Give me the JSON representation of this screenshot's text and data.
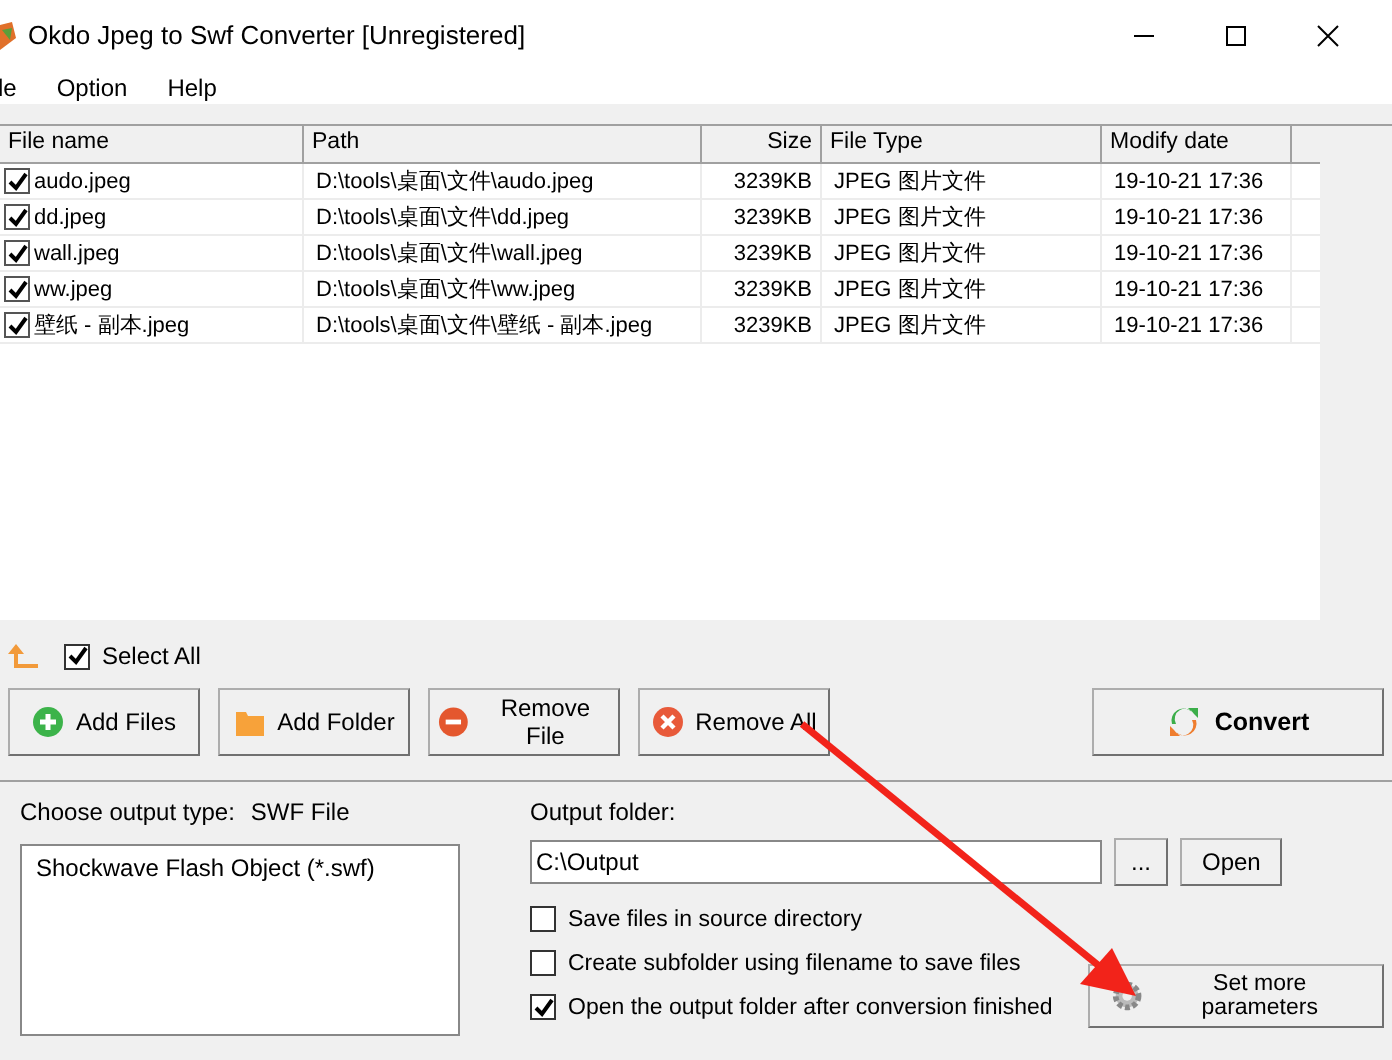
{
  "window": {
    "title": "Okdo Jpeg to Swf Converter [Unregistered]"
  },
  "menu": [
    "le",
    "Option",
    "Help"
  ],
  "table": {
    "columns": [
      "File name",
      "Path",
      "Size",
      "File Type",
      "Modify date"
    ],
    "rows": [
      {
        "checked": true,
        "cells": [
          "audo.jpeg",
          "D:\\tools\\桌面\\文件\\audo.jpeg",
          "3239KB",
          "JPEG 图片文件",
          "19-10-21 17:36"
        ]
      },
      {
        "checked": true,
        "cells": [
          "dd.jpeg",
          "D:\\tools\\桌面\\文件\\dd.jpeg",
          "3239KB",
          "JPEG 图片文件",
          "19-10-21 17:36"
        ]
      },
      {
        "checked": true,
        "cells": [
          "wall.jpeg",
          "D:\\tools\\桌面\\文件\\wall.jpeg",
          "3239KB",
          "JPEG 图片文件",
          "19-10-21 17:36"
        ]
      },
      {
        "checked": true,
        "cells": [
          "ww.jpeg",
          "D:\\tools\\桌面\\文件\\ww.jpeg",
          "3239KB",
          "JPEG 图片文件",
          "19-10-21 17:36"
        ]
      },
      {
        "checked": true,
        "cells": [
          "壁纸 - 副本.jpeg",
          "D:\\tools\\桌面\\文件\\壁纸 - 副本.jpeg",
          "3239KB",
          "JPEG 图片文件",
          "19-10-21 17:36"
        ]
      }
    ]
  },
  "select_all": {
    "label": "Select All",
    "checked": true
  },
  "buttons": [
    {
      "kind": "add",
      "label": "Add Files"
    },
    {
      "kind": "folder",
      "label": "Add Folder"
    },
    {
      "kind": "remove",
      "label": "Remove File"
    },
    {
      "kind": "clear",
      "label": "Remove All"
    }
  ],
  "convert_button": "Convert",
  "output_type": {
    "label": "Choose output type:",
    "value": "SWF File",
    "items": [
      "Shockwave Flash Object (*.swf)"
    ]
  },
  "output_folder": {
    "label": "Output folder:",
    "value": "C:\\Output",
    "browse": "...",
    "open": "Open"
  },
  "options": [
    {
      "label": "Save files in source directory",
      "checked": false
    },
    {
      "label": "Create subfolder using filename to save files",
      "checked": false
    },
    {
      "label": "Open the output folder after conversion finished",
      "checked": true
    }
  ],
  "more_button": "Set more parameters"
}
